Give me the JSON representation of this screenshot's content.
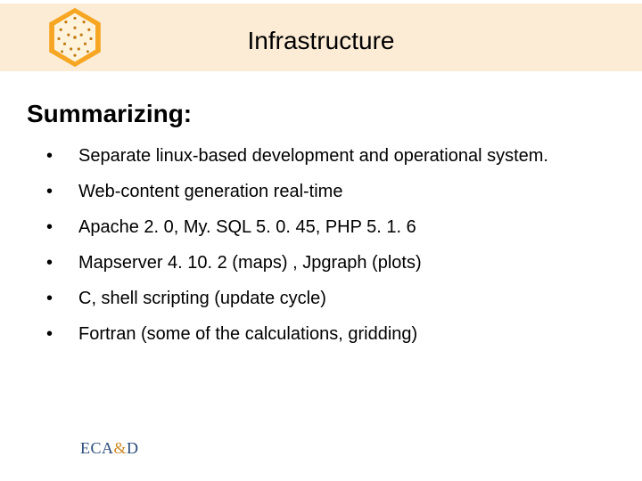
{
  "header": {
    "title": "Infrastructure"
  },
  "section": {
    "heading": "Summarizing:"
  },
  "bullets": [
    {
      "text": "Separate linux-based development and operational system."
    },
    {
      "text": "Web-content generation real-time"
    },
    {
      "text": "Apache 2. 0, My. SQL 5. 0. 45, PHP 5. 1. 6"
    },
    {
      "text": "Mapserver 4. 10. 2 (maps) , Jpgraph (plots)"
    },
    {
      "text": "C, shell scripting (update cycle)"
    },
    {
      "text": "Fortran (some of the calculations, gridding)"
    }
  ],
  "footer": {
    "logo_eca": "ECA",
    "logo_amp": "&",
    "logo_d": "D"
  },
  "colors": {
    "band": "#fcecd6",
    "hex_outer": "#f6a623",
    "hex_inner": "#fff3dc"
  }
}
